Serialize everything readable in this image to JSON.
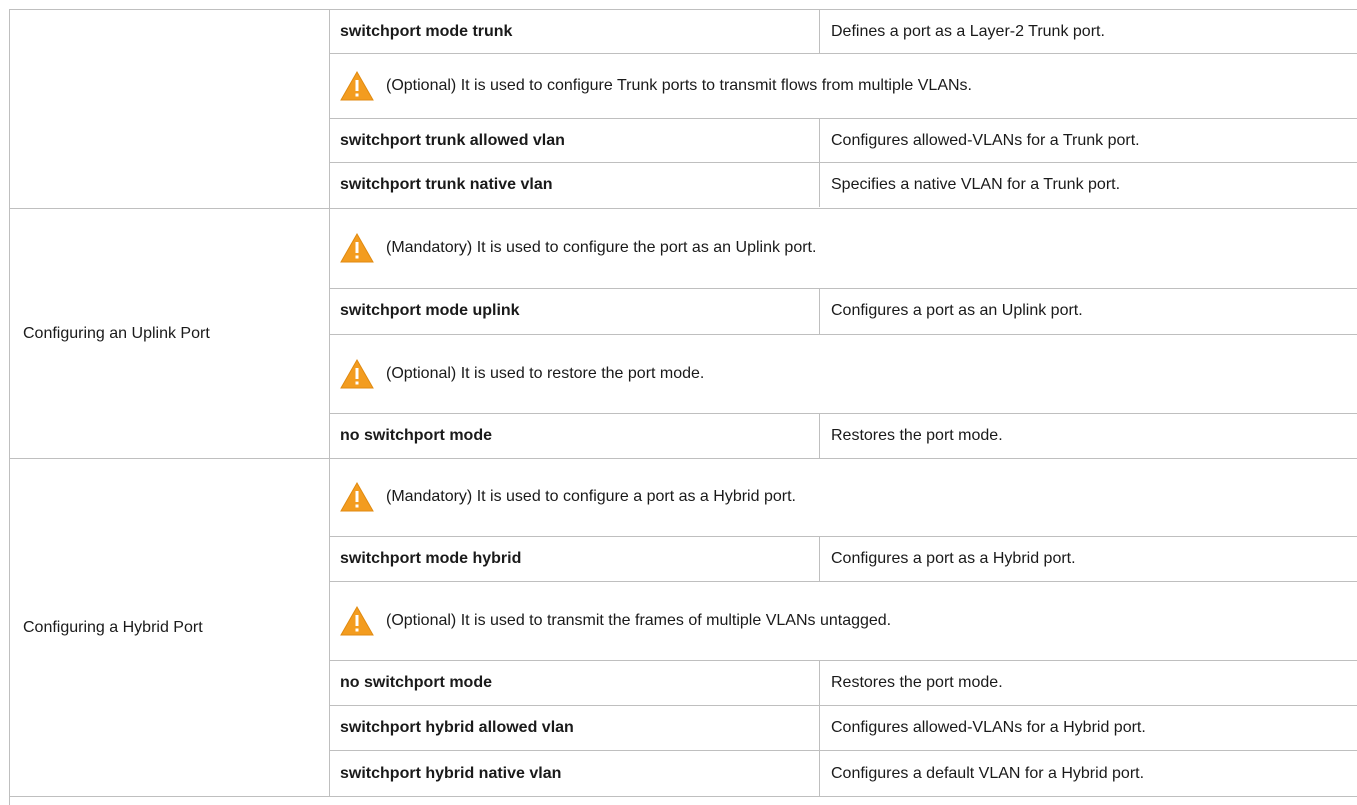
{
  "groups": [
    {
      "label": "",
      "rows": [
        {
          "type": "cmd",
          "command": "switchport mode trunk",
          "desc": "Defines a port as a Layer-2 Trunk port."
        },
        {
          "type": "note",
          "icon": "warning-icon",
          "text": "(Optional) It is used to configure Trunk ports to transmit flows from multiple VLANs."
        },
        {
          "type": "cmd",
          "command": "switchport trunk allowed vlan",
          "desc": "Configures allowed-VLANs for a Trunk port."
        },
        {
          "type": "cmd",
          "command": "switchport trunk native vlan",
          "desc": "Specifies a native VLAN for a Trunk port."
        }
      ]
    },
    {
      "label": "Configuring an Uplink Port",
      "rows": [
        {
          "type": "note",
          "icon": "warning-icon",
          "text": "(Mandatory) It is used to configure the port as an Uplink port."
        },
        {
          "type": "cmd",
          "command": "switchport mode uplink",
          "desc": "Configures a port as an Uplink port."
        },
        {
          "type": "note",
          "icon": "warning-icon",
          "text": "(Optional) It is used to restore the port mode."
        },
        {
          "type": "cmd",
          "command": "no switchport mode",
          "desc": "Restores the port mode."
        }
      ]
    },
    {
      "label": "Configuring a Hybrid Port",
      "rows": [
        {
          "type": "note",
          "icon": "warning-icon",
          "text": "(Mandatory) It is used to configure a port as a Hybrid port."
        },
        {
          "type": "cmd",
          "command": "switchport mode hybrid",
          "desc": "Configures a port as a Hybrid port."
        },
        {
          "type": "note",
          "icon": "warning-icon",
          "text": "(Optional) It is used to transmit the frames of multiple VLANs untagged."
        },
        {
          "type": "cmd",
          "command": "no switchport mode",
          "desc": "Restores the port mode."
        },
        {
          "type": "cmd",
          "command": "switchport hybrid allowed vlan",
          "desc": "Configures allowed-VLANs for a Hybrid port."
        },
        {
          "type": "cmd",
          "command": "switchport hybrid native vlan",
          "desc": "Configures a default VLAN for a Hybrid port."
        }
      ]
    }
  ],
  "colors": {
    "warning_fill": "#f39c1f",
    "warning_mark": "#ffffff",
    "border": "#bfbfbf"
  }
}
